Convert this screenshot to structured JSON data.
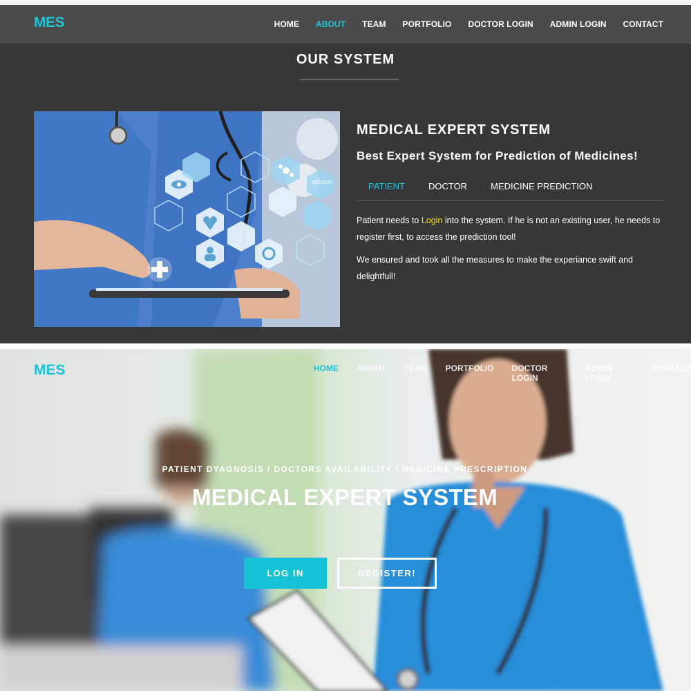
{
  "about_view": {
    "brand": "MES",
    "nav": [
      "HOME",
      "ABOUT",
      "TEAM",
      "PORTFOLIO",
      "DOCTOR LOGIN",
      "ADMIN LOGIN",
      "CONTACT"
    ],
    "active_nav": "ABOUT",
    "section_title": "OUR SYSTEM",
    "heading": "MEDICAL EXPERT SYSTEM",
    "subheading": "Best Expert System for Prediction of Medicines!",
    "image_label": "MEDICAL",
    "tabs": [
      "PATIENT",
      "DOCTOR",
      "MEDICINE PREDICTION"
    ],
    "active_tab": "PATIENT",
    "paragraph1_before": "Patient needs to ",
    "paragraph1_link": "Login",
    "paragraph1_after": " into the system. If he is not an existing user, he needs to register first, to access the prediction tool!",
    "paragraph2": "We ensured and took all the measures to make the experiance swift and delightfull!"
  },
  "hero_view": {
    "brand": "MES",
    "nav": [
      "HOME",
      "ABOUT",
      "TEAM",
      "PORTFOLIO",
      "DOCTOR LOGIN",
      "ADMIN LOGIN",
      "CONTACT"
    ],
    "active_nav": "HOME",
    "tagline": "PATIENT DYAGNOSIS / DOCTORS AVAILABILITY / MEDICINE PRESCRIPTION",
    "title": "MEDICAL EXPERT SYSTEM",
    "login_button": "LOG IN",
    "register_button": "REGISTER!"
  },
  "colors": {
    "accent": "#1ec3d6",
    "link_highlight": "#f3e21b",
    "about_bg": "#373737",
    "navbar_bg": "#4a4a4a"
  }
}
